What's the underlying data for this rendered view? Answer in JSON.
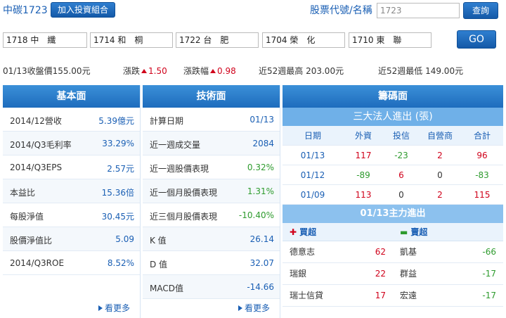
{
  "header": {
    "stock_title": "中碳1723",
    "add_portfolio_label": "加入投資組合",
    "code_label": "股票代號/名稱",
    "code_input_value": "1723",
    "query_label": "查詢"
  },
  "compare": {
    "fields": [
      "1718 中　纖",
      "1714 和　桐",
      "1722 台　肥",
      "1704 榮　化",
      "1710 東　聯"
    ],
    "go_label": "GO"
  },
  "price": {
    "close_text": "01/13收盤價155.00元",
    "change_label": "漲跌",
    "change_value": "1.50",
    "change_pct_label": "漲跌幅",
    "change_pct_value": "0.98",
    "high52_text": "近52週最高 203.00元",
    "low52_text": "近52週最低 149.00元"
  },
  "fundamentals": {
    "title": "基本面",
    "rows": [
      {
        "label": "2014/12營收",
        "value": "5.39億元"
      },
      {
        "label": "2014/Q3毛利率",
        "value": "33.29%"
      },
      {
        "label": "2014/Q3EPS",
        "value": "2.57元"
      },
      {
        "label": "本益比",
        "value": "15.36倍"
      },
      {
        "label": "每股淨值",
        "value": "30.45元"
      },
      {
        "label": "股價淨值比",
        "value": "5.09"
      },
      {
        "label": "2014/Q3ROE",
        "value": "8.52%"
      }
    ],
    "more_label": "看更多"
  },
  "technical": {
    "title": "技術面",
    "rows": [
      {
        "label": "計算日期",
        "value": "01/13"
      },
      {
        "label": "近一週成交量",
        "value": "2084"
      },
      {
        "label": "近一週股價表現",
        "value": "0.32%"
      },
      {
        "label": "近一個月股價表現",
        "value": "1.31%"
      },
      {
        "label": "近三個月股價表現",
        "value": "-10.40%"
      },
      {
        "label": "K 值",
        "value": "26.14"
      },
      {
        "label": "D 值",
        "value": "32.07"
      },
      {
        "label": "MACD值",
        "value": "-14.66"
      }
    ],
    "more_label": "看更多"
  },
  "chips": {
    "title": "籌碼面",
    "institutional_title": "三大法人進出 (張)",
    "columns": [
      "日期",
      "外資",
      "投信",
      "自營商",
      "合計"
    ],
    "rows": [
      {
        "date": "01/13",
        "foreign": "117",
        "trust": "-23",
        "dealer": "2",
        "total": "96"
      },
      {
        "date": "01/12",
        "foreign": "-89",
        "trust": "6",
        "dealer": "0",
        "total": "-83"
      },
      {
        "date": "01/09",
        "foreign": "113",
        "trust": "0",
        "dealer": "2",
        "total": "115"
      }
    ],
    "main_force_title": "01/13主力進出",
    "buy_label": "買超",
    "sell_label": "賣超",
    "main_rows": [
      {
        "buyer": "德意志",
        "buy": "62",
        "seller": "凱基",
        "sell": "-66"
      },
      {
        "buyer": "瑞銀",
        "buy": "22",
        "seller": "群益",
        "sell": "-17"
      },
      {
        "buyer": "瑞士信貸",
        "buy": "17",
        "seller": "宏遠",
        "sell": "-17"
      }
    ]
  },
  "colors": {
    "accent": "#1e6cbd",
    "up": "#d0021b",
    "down": "#2e9b2e"
  }
}
